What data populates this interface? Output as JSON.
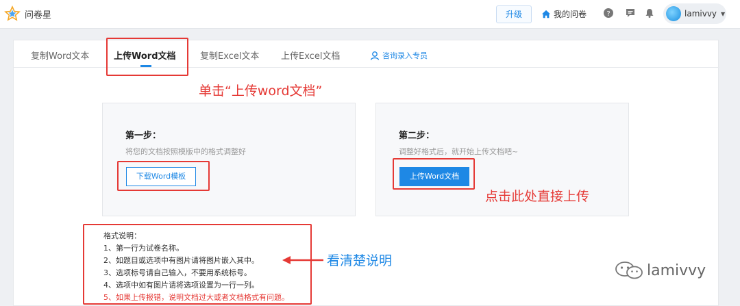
{
  "app": {
    "name": "问卷星"
  },
  "header": {
    "upgrade_label": "升级",
    "my_surveys_label": "我的问卷",
    "user_name": "lamivvy"
  },
  "tabs": [
    {
      "label": "复制Word文本",
      "active": false
    },
    {
      "label": "上传Word文档",
      "active": true
    },
    {
      "label": "复制Excel文本",
      "active": false
    },
    {
      "label": "上传Excel文档",
      "active": false
    }
  ],
  "consult_label": "咨询录入专员",
  "step1": {
    "title": "第一步：",
    "desc": "将您的文档按照模版中的格式调整好",
    "button_label": "下载Word模板"
  },
  "step2": {
    "title": "第二步：",
    "desc": "调整好格式后，就开始上传文档吧~",
    "button_label": "上传Word文档"
  },
  "format_notes": {
    "heading": "格式说明：",
    "items": [
      "1、第一行为试卷名称。",
      "2、如题目或选项中有图片请将图片嵌入其中。",
      "3、选项标号请自己输入，不要用系统标号。",
      "4、选项中如有图片请将选项设置为一行一列。",
      "5、如果上传报错，说明文档过大或者文档格式有问题。"
    ]
  },
  "annotations": {
    "click_tab": "单击“上传word文档”",
    "click_upload": "点击此处直接上传",
    "read_notes": "看清楚说明"
  },
  "watermark": "lamivvy",
  "colors": {
    "accent": "#1e88e5",
    "annotation_red": "#e53935"
  }
}
